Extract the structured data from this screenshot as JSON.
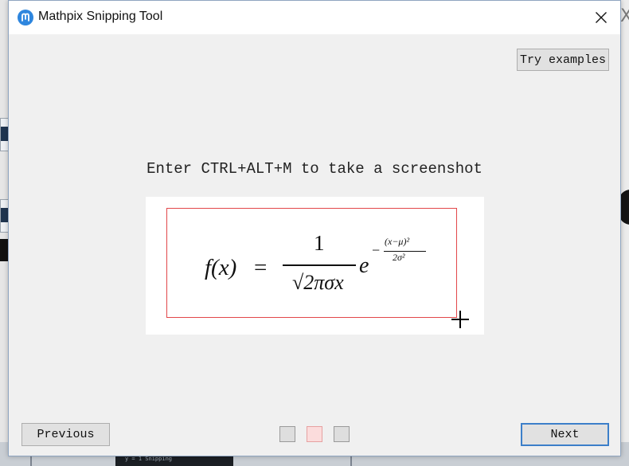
{
  "window": {
    "title": "Mathpix Snipping Tool",
    "close_glyph": "✕"
  },
  "buttons": {
    "try_examples": "Try examples",
    "previous": "Previous",
    "next": "Next"
  },
  "instruction": "Enter CTRL+ALT+M to take a screenshot",
  "example": {
    "lhs": "f(x)",
    "equals": "=",
    "numerator": "1",
    "denominator": "√2πσx",
    "base": "e",
    "exponent_sign": "−",
    "exponent_numerator": "(x−μ)²",
    "exponent_denominator": "2σ²"
  },
  "pagination": {
    "total": 3,
    "current": 2
  },
  "background": {
    "right_glyph": "X",
    "bottom_snippet": "y = 1 Snipping"
  },
  "icons": {
    "app": "mathpix-logo-icon",
    "close": "close-icon",
    "cursor": "crosshair-cursor-icon"
  },
  "colors": {
    "accent": "#2e86de",
    "selection": "#e2474a",
    "active_dot": "#fbdcdc",
    "next_border": "#3c7fc9"
  }
}
